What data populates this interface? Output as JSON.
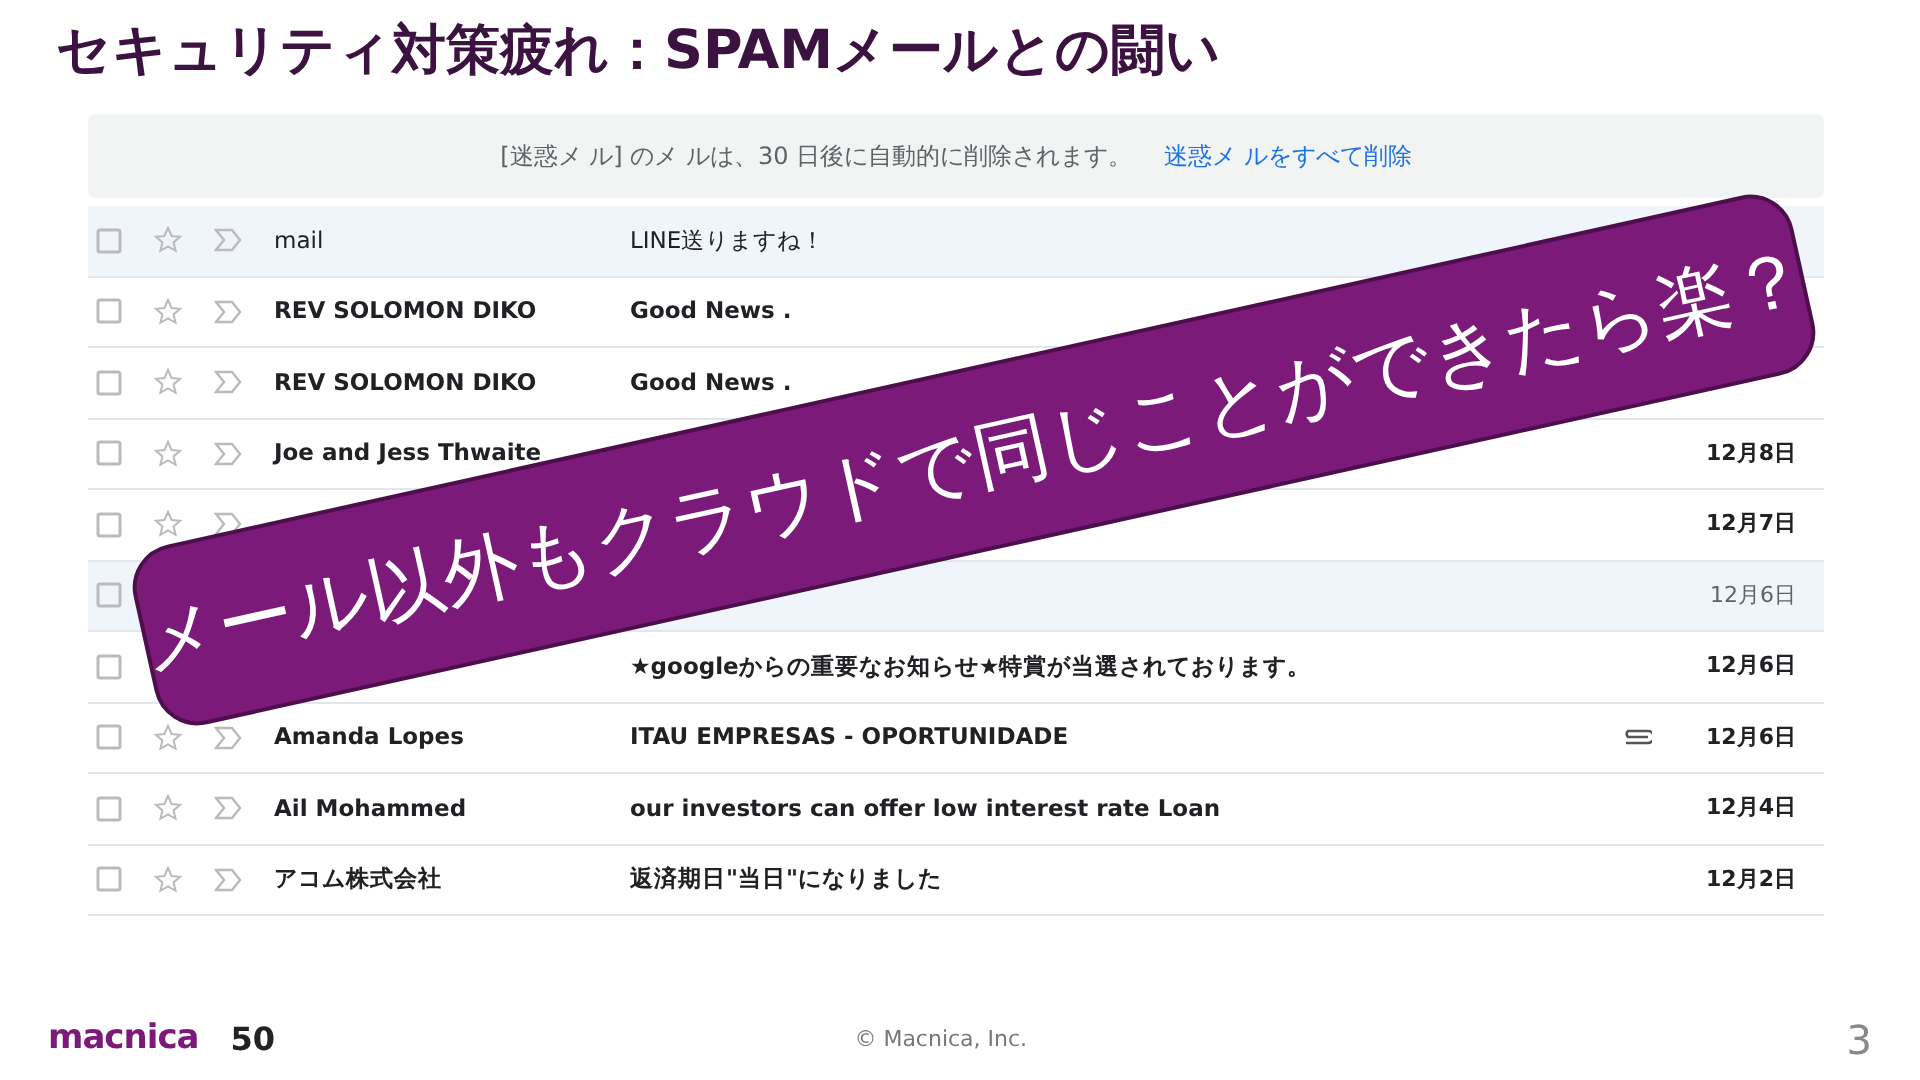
{
  "slide": {
    "title": "セキュリティ対策疲れ：SPAMメールとの闘い",
    "footer": "© Macnica, Inc.",
    "page_number": "3",
    "logo": "macnica",
    "logo_badge": "50"
  },
  "mail": {
    "notice": "[迷惑メ ル] のメ ルは、30 日後に自動的に削除されます。",
    "notice_link": "迷惑メ ルをすべて削除",
    "rows": [
      {
        "sender": "mail",
        "subject": "LINE送りますね！",
        "date": "",
        "unread": false,
        "attachment": false
      },
      {
        "sender": "REV SOLOMON DIKO",
        "subject": "Good News .",
        "date": "",
        "unread": true,
        "attachment": false
      },
      {
        "sender": "REV SOLOMON DIKO",
        "subject": "Good News .",
        "date": "",
        "unread": true,
        "attachment": false
      },
      {
        "sender": "Joe and Jess Thwaite",
        "subject": "",
        "date": "12月8日",
        "unread": true,
        "attachment": false
      },
      {
        "sender": "",
        "subject": "",
        "date": "12月7日",
        "unread": true,
        "attachment": false
      },
      {
        "sender": "",
        "subject": "",
        "date": "12月6日",
        "unread": false,
        "attachment": false
      },
      {
        "sender": "",
        "subject": "★googleからの重要なお知らせ★特賞が当選されております。",
        "date": "12月6日",
        "unread": true,
        "attachment": false
      },
      {
        "sender": "Amanda Lopes",
        "subject": "ITAU EMPRESAS - OPORTUNIDADE",
        "date": "12月6日",
        "unread": true,
        "attachment": true
      },
      {
        "sender": "Ail Mohammed",
        "subject": "our investors can offer low interest rate Loan",
        "date": "12月4日",
        "unread": true,
        "attachment": false
      },
      {
        "sender": "アコム株式会社",
        "subject": "返済期日\"当日\"になりました",
        "date": "12月2日",
        "unread": true,
        "attachment": false
      }
    ]
  },
  "callout": {
    "text": "メール以外もクラウドで同じことができたら楽？"
  }
}
